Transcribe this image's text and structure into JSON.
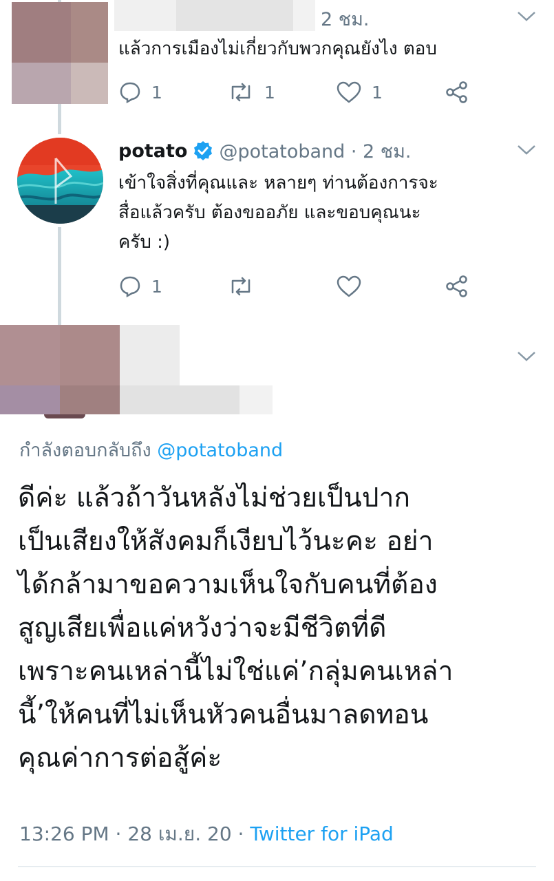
{
  "reply_tweet": {
    "time": "2 ชม.",
    "text": "แล้วการเมืองไม่เกี่ยวกับพวกคุณยังไง ตอบ",
    "reply_count": "1",
    "retweet_count": "1",
    "like_count": "1"
  },
  "potato_tweet": {
    "name": "potato",
    "handle_time": "@potatoband · 2 ชม.",
    "text_line1": "เข้าใจสิ่งที่คุณและ หลายๆ ท่านต้องการจะ",
    "text_line2": "สื่อแล้วครับ ต้องขออภัย และขอบคุณนะ",
    "text_line3": "ครับ :)",
    "reply_count": "1"
  },
  "main_tweet": {
    "reply_to_label": "กำลังตอบกลับถึง",
    "reply_to_handle": "@potatoband",
    "text_lines": [
      "ดีค่ะ แล้วถ้าวันหลังไม่ช่วยเป็นปาก",
      "เป็นเสียงให้สังคมก็เงียบไว้นะคะ อย่า",
      "ได้กล้ามาขอความเห็นใจกับคนที่ต้อง",
      "สูญเสียเพื่อแค่หวังว่าจะมีชีวิตที่ดี",
      "เพราะคนเหล่านี้ไม่ใช่แค่’กลุ่มคนเหล่า",
      "นี้’ให้คนที่ไม่เห็นหัวคนอื่นมาลดทอน",
      "คุณค่าการต่อสู้ค่ะ"
    ],
    "timestamp": "13:26 PM · 28 เม.ย. 20 · ",
    "source": "Twitter for iPad"
  },
  "colors": {
    "text": "#14171a",
    "muted": "#657786",
    "accent": "#1da1f2"
  }
}
